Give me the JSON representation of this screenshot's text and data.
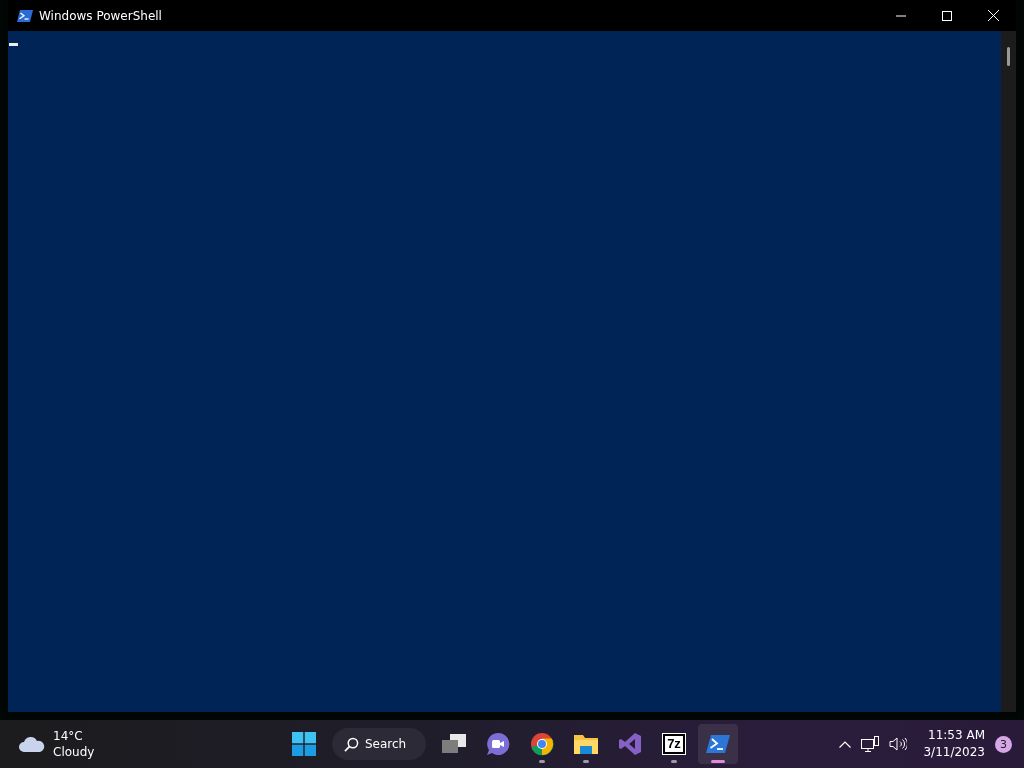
{
  "window": {
    "title": "Windows PowerShell"
  },
  "taskbar": {
    "weather": {
      "temperature": "14°C",
      "condition": "Cloudy"
    },
    "search": {
      "label": "Search"
    },
    "apps": [
      {
        "kind": "taskview",
        "running": false,
        "active": false
      },
      {
        "kind": "chat",
        "running": false,
        "active": false
      },
      {
        "kind": "chrome",
        "running": true,
        "active": false
      },
      {
        "kind": "files",
        "running": true,
        "active": false
      },
      {
        "kind": "vs",
        "running": false,
        "active": false
      },
      {
        "kind": "sevenzip",
        "label": "7z",
        "running": true,
        "active": false
      },
      {
        "kind": "powershell",
        "running": true,
        "active": true
      }
    ],
    "clock": {
      "time": "11:53 AM",
      "date": "3/11/2023"
    },
    "notifications": "3"
  }
}
